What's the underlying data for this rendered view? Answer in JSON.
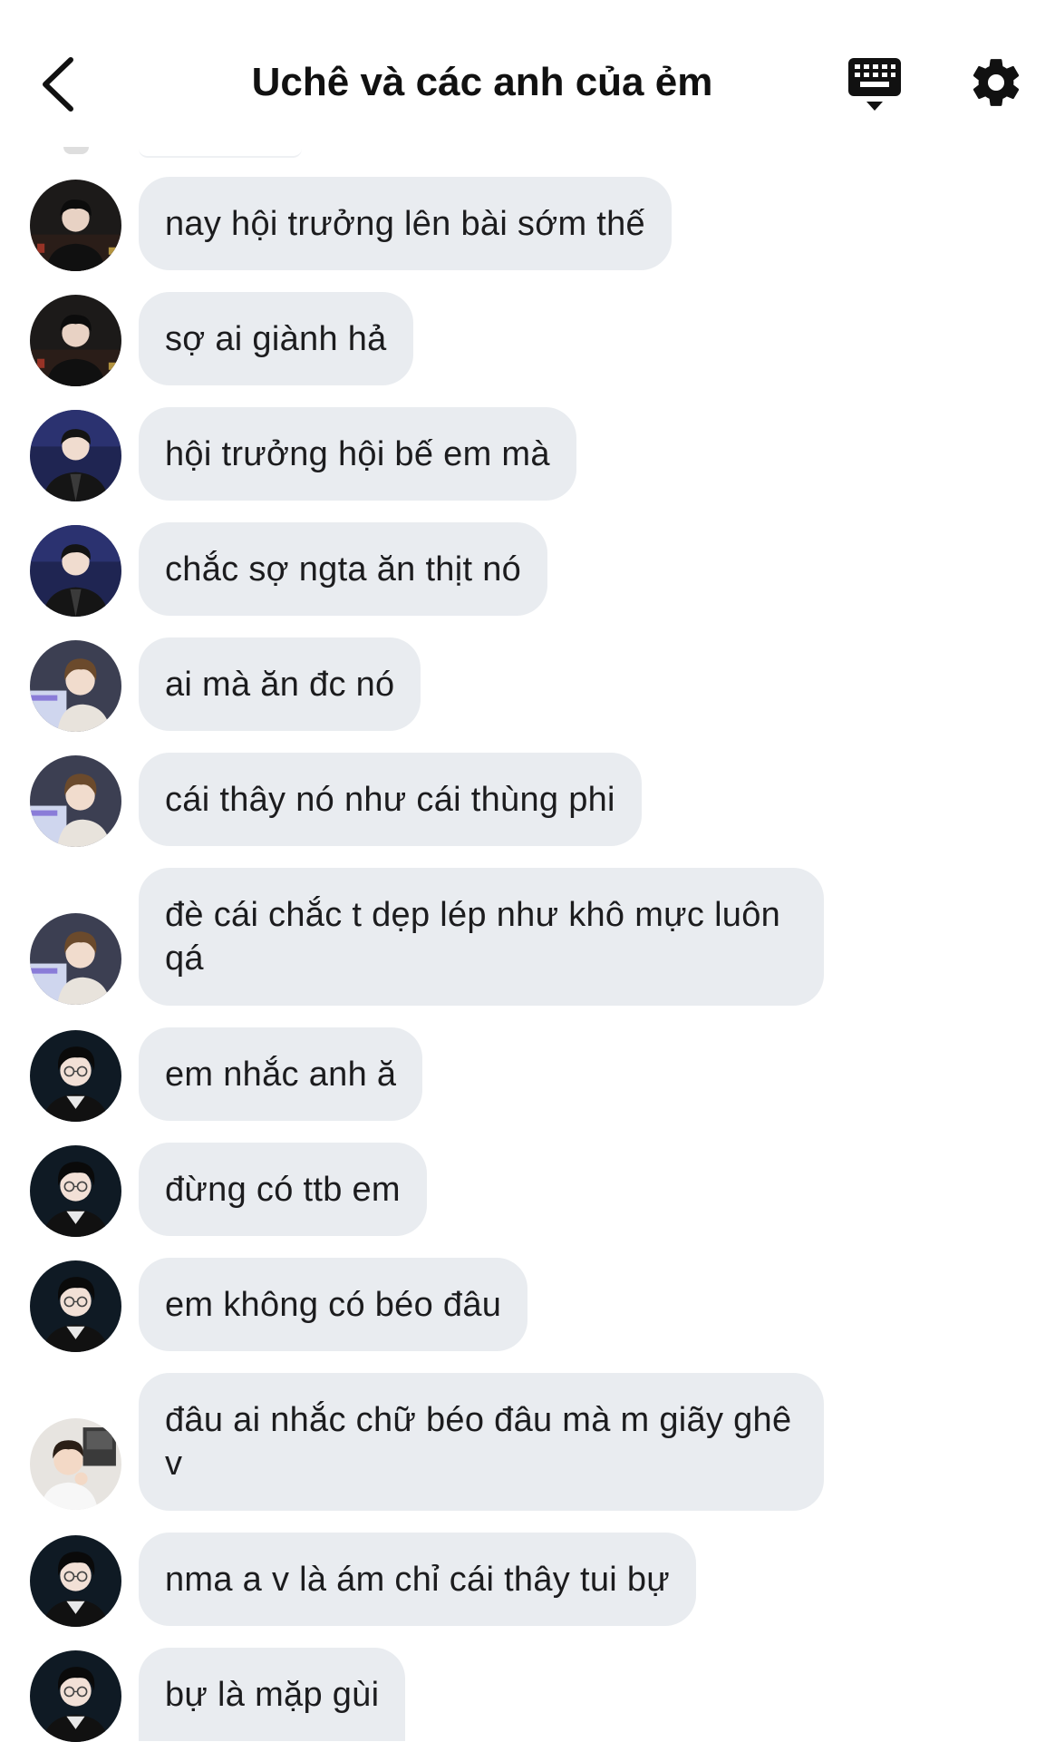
{
  "header": {
    "title": "Uchê và các anh của ẻm",
    "back_icon": "chevron-left-icon",
    "keyboard_icon": "keyboard-icon",
    "settings_icon": "gear-icon"
  },
  "colors": {
    "bubble": "#e9ecf0",
    "text": "#1c1c1e",
    "background": "#ffffff"
  },
  "messages": [
    {
      "avatar": "avatar-a",
      "text": "nay hội trưởng lên bài sớm thế"
    },
    {
      "avatar": "avatar-a",
      "text": "sợ ai giành hả"
    },
    {
      "avatar": "avatar-b",
      "text": "hội trưởng hội bế em mà"
    },
    {
      "avatar": "avatar-b",
      "text": "chắc sợ ngta ăn thịt nó"
    },
    {
      "avatar": "avatar-c",
      "text": "ai mà ăn đc nó"
    },
    {
      "avatar": "avatar-c",
      "text": "cái thây nó như cái thùng phi"
    },
    {
      "avatar": "avatar-c",
      "text": "đè cái chắc t dẹp lép như khô mực luôn qá"
    },
    {
      "avatar": "avatar-d",
      "text": "em nhắc anh ă"
    },
    {
      "avatar": "avatar-d",
      "text": "đừng có ttb em"
    },
    {
      "avatar": "avatar-d",
      "text": "em không có béo đâu"
    },
    {
      "avatar": "avatar-e",
      "text": "đâu ai nhắc chữ béo đâu mà m giãy ghê v"
    },
    {
      "avatar": "avatar-d",
      "text": "nma a v là ám chỉ cái thây tui bự"
    },
    {
      "avatar": "avatar-d",
      "text": "bự là mặp gùi"
    }
  ]
}
